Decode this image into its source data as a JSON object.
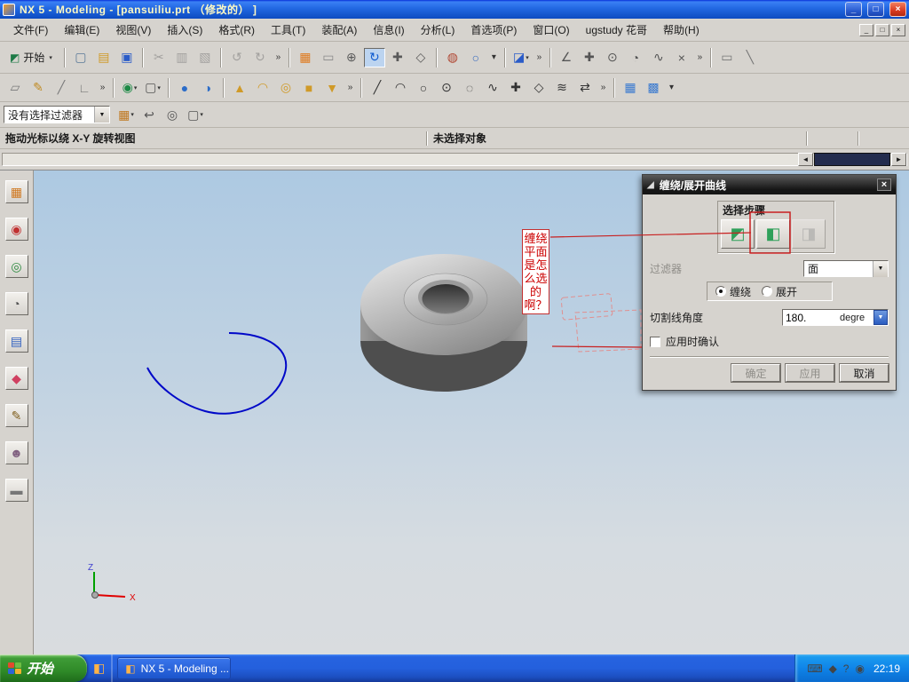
{
  "window": {
    "title": "NX 5 - Modeling - [pansuiliu.prt （修改的） ]",
    "controls": {
      "minimize": "_",
      "restore": "□",
      "close": "×"
    }
  },
  "menu": {
    "items": [
      "文件(F)",
      "编辑(E)",
      "视图(V)",
      "插入(S)",
      "格式(R)",
      "工具(T)",
      "装配(A)",
      "信息(I)",
      "分析(L)",
      "首选项(P)",
      "窗口(O)",
      "ugstudy 花哥",
      "帮助(H)"
    ],
    "mdi_controls": {
      "minimize": "_",
      "restore": "□",
      "close": "×"
    }
  },
  "toolbars": {
    "row1": [
      {
        "name": "start-menu-button",
        "glyph": "◩",
        "color": "#1d7a46",
        "label": "开始",
        "dd": true
      },
      {
        "sep": true
      },
      {
        "name": "new-file-icon",
        "glyph": "▢",
        "color": "#5b7a99"
      },
      {
        "name": "open-icon",
        "glyph": "▤",
        "color": "#d09a28"
      },
      {
        "name": "save-icon",
        "glyph": "▣",
        "color": "#2b5cc8"
      },
      {
        "sep": true
      },
      {
        "name": "cut-icon",
        "glyph": "✂",
        "color": "#6f6f6f",
        "disabled": true
      },
      {
        "name": "copy-icon",
        "glyph": "▥",
        "color": "#6f6f6f",
        "disabled": true
      },
      {
        "name": "paste-icon",
        "glyph": "▧",
        "color": "#6f6f6f",
        "disabled": true
      },
      {
        "sep": true
      },
      {
        "name": "undo-icon",
        "glyph": "↺",
        "color": "#6f6f6f",
        "disabled": true
      },
      {
        "name": "redo-icon",
        "glyph": "↻",
        "color": "#6f6f6f",
        "disabled": true
      },
      {
        "name": "edit-more-icon",
        "glyph": "»",
        "color": "#333",
        "small": true
      },
      {
        "sep": true
      },
      {
        "name": "fit-view-icon",
        "glyph": "▦",
        "color": "#e07a1e"
      },
      {
        "name": "zoom-window-icon",
        "glyph": "▭",
        "color": "#8a8a8a"
      },
      {
        "name": "zoom-icon",
        "glyph": "⊕",
        "color": "#5a5a5a"
      },
      {
        "name": "rotate-view-icon",
        "glyph": "↻",
        "color": "#0f5bd0",
        "active": true
      },
      {
        "name": "pan-view-icon",
        "glyph": "✚",
        "color": "#5a5a5a"
      },
      {
        "name": "perspective-icon",
        "glyph": "◇",
        "color": "#5a5a5a"
      },
      {
        "sep": true
      },
      {
        "name": "shaded-display-icon",
        "glyph": "◍",
        "color": "#b04632"
      },
      {
        "name": "wireframe-display-icon",
        "glyph": "○",
        "color": "#3a6cc0"
      },
      {
        "name": "display-more-icon",
        "glyph": "▾",
        "color": "#333",
        "small": true
      },
      {
        "sep": true
      },
      {
        "name": "orient-view-cube-icon",
        "glyph": "◪",
        "color": "#2b5cc8",
        "dd": true
      },
      {
        "name": "view-more-icon",
        "glyph": "»",
        "color": "#333",
        "small": true
      },
      {
        "sep": true
      },
      {
        "name": "snap-angle-icon",
        "glyph": "∠",
        "color": "#555"
      },
      {
        "name": "snap-point-icon",
        "glyph": "✚",
        "color": "#555"
      },
      {
        "name": "snap-center-icon",
        "glyph": "⊙",
        "color": "#555"
      },
      {
        "name": "snap-quadrant-icon",
        "glyph": "◔",
        "color": "#555"
      },
      {
        "name": "snap-curve-icon",
        "glyph": "∿",
        "color": "#555"
      },
      {
        "name": "snap-intersection-icon",
        "glyph": "×",
        "color": "#555"
      },
      {
        "name": "snap-more-icon",
        "glyph": "»",
        "color": "#333",
        "small": true
      },
      {
        "sep": true
      },
      {
        "name": "measure-distance-icon",
        "glyph": "▭",
        "color": "#777"
      },
      {
        "name": "section-line-icon",
        "glyph": "╲",
        "color": "#777"
      }
    ],
    "row2": [
      {
        "name": "datum-plane-icon",
        "glyph": "▱",
        "color": "#7a7a7a"
      },
      {
        "name": "sketch-icon",
        "glyph": "✎",
        "color": "#c08a20"
      },
      {
        "name": "datum-axis-icon",
        "glyph": "╱",
        "color": "#7a7a7a"
      },
      {
        "name": "datum-csys-icon",
        "glyph": "∟",
        "color": "#7a7a7a"
      },
      {
        "name": "datum-more-icon",
        "glyph": "»",
        "color": "#333",
        "small": true
      },
      {
        "sep": true
      },
      {
        "name": "point-constructor-icon",
        "glyph": "◉",
        "color": "#1d8a46",
        "dd": true
      },
      {
        "name": "rectangle-tool-icon",
        "glyph": "▢",
        "color": "#555",
        "dd": true
      },
      {
        "sep": true
      },
      {
        "name": "shaded-cube-icon",
        "glyph": "●",
        "color": "#2b6cc8"
      },
      {
        "name": "isometric-cube-icon",
        "glyph": "◑",
        "color": "#2b6cc8"
      },
      {
        "sep": true
      },
      {
        "name": "extrude-icon",
        "glyph": "▲",
        "color": "#d09a28"
      },
      {
        "name": "revolve-icon",
        "glyph": "◠",
        "color": "#d09a28"
      },
      {
        "name": "hole-icon",
        "glyph": "◎",
        "color": "#d09a28"
      },
      {
        "name": "block-icon",
        "glyph": "■",
        "color": "#d09a28"
      },
      {
        "name": "shell-icon",
        "glyph": "▼",
        "color": "#d09a28"
      },
      {
        "name": "feature-more-icon",
        "glyph": "»",
        "color": "#333",
        "small": true
      },
      {
        "sep": true
      },
      {
        "name": "line-icon",
        "glyph": "╱",
        "color": "#333"
      },
      {
        "name": "arc-icon",
        "glyph": "◠",
        "color": "#333"
      },
      {
        "name": "circle-icon",
        "glyph": "○",
        "color": "#333"
      },
      {
        "name": "circle-center-icon",
        "glyph": "⊙",
        "color": "#333"
      },
      {
        "name": "ellipse-icon",
        "glyph": "◌",
        "color": "#333"
      },
      {
        "name": "spline-icon",
        "glyph": "∿",
        "color": "#333"
      },
      {
        "name": "point-icon",
        "glyph": "✚",
        "color": "#333"
      },
      {
        "name": "polygon-icon",
        "glyph": "◇",
        "color": "#333"
      },
      {
        "name": "offset-curve-icon",
        "glyph": "≋",
        "color": "#333"
      },
      {
        "name": "mirror-curve-icon",
        "glyph": "⇄",
        "color": "#333"
      },
      {
        "name": "curve-more-icon",
        "glyph": "»",
        "color": "#333",
        "small": true
      },
      {
        "sep": true
      },
      {
        "name": "through-curve-mesh-icon",
        "glyph": "▦",
        "color": "#3a7ad0"
      },
      {
        "name": "swept-surface-icon",
        "glyph": "▩",
        "color": "#3a7ad0"
      },
      {
        "name": "surface-more-icon",
        "glyph": "▾",
        "color": "#333",
        "small": true
      }
    ]
  },
  "selection_bar": {
    "filter_value": "没有选择过滤器",
    "arrow_glyph": "▼",
    "icons": [
      {
        "name": "filter-grid-icon",
        "glyph": "▦",
        "color": "#c07820",
        "dd": true
      },
      {
        "name": "select-previous-icon",
        "glyph": "↩",
        "color": "#555"
      },
      {
        "name": "snap-toggle-icon",
        "glyph": "◎",
        "color": "#555"
      },
      {
        "name": "select-rect-icon",
        "glyph": "▢",
        "color": "#555",
        "dd": true
      }
    ]
  },
  "status_bar": {
    "prompt": "拖动光标以绕 X-Y 旋转视图",
    "status": "未选择对象"
  },
  "scroll_strip": {
    "left_arrow": "◄",
    "right_arrow": "►"
  },
  "resource_bar": {
    "icons": [
      {
        "name": "assembly-navigator-icon",
        "glyph": "▦",
        "color": "#d07820"
      },
      {
        "name": "constraint-navigator-icon",
        "glyph": "◉",
        "color": "#c03030"
      },
      {
        "name": "part-navigator-icon",
        "glyph": "◎",
        "color": "#2e8b40"
      },
      {
        "name": "reuse-library-icon",
        "glyph": "◔",
        "color": "#555"
      },
      {
        "name": "hd3d-tools-icon",
        "glyph": "▤",
        "color": "#3060c0"
      },
      {
        "name": "palette-icon",
        "glyph": "◆",
        "color": "#d04060"
      },
      {
        "name": "history-icon",
        "glyph": "✎",
        "color": "#806020"
      },
      {
        "name": "roles-icon",
        "glyph": "☻",
        "color": "#806080"
      },
      {
        "name": "windows-panel-icon",
        "glyph": "▬",
        "color": "#777"
      }
    ]
  },
  "scene": {
    "note_text": "缠绕平面是怎么选的啊？",
    "triad": {
      "x_label": "X",
      "z_label": "Z"
    }
  },
  "dialog": {
    "title": "缠绕/展开曲线",
    "title_icon": "◢",
    "close_glyph": "×",
    "selection_steps_label": "选择步骤",
    "steps": [
      {
        "name": "step-face-button",
        "glyph": "◩",
        "color": "#2fa05a"
      },
      {
        "name": "step-plane-button",
        "glyph": "◧",
        "color": "#2fa05a"
      },
      {
        "name": "step-curve-button",
        "glyph": "◨",
        "color": "#9a9a9a",
        "disabled": true
      }
    ],
    "filter_label": "过滤器",
    "filter_value": "面",
    "arrow_glyph": "▼",
    "wrap_label": "缠绕",
    "unwrap_label": "展开",
    "angle_label": "切割线角度",
    "angle_value": "180.",
    "angle_unit": "degre",
    "confirm_label": "应用时确认",
    "ok_label": "确定",
    "apply_label": "应用",
    "cancel_label": "取消"
  },
  "taskbar": {
    "start_label": "开始",
    "task_label": "NX 5 - Modeling ...",
    "tray_icons": [
      {
        "name": "ime-keyboard-icon",
        "glyph": "⌨"
      },
      {
        "name": "messenger-tray-icon",
        "glyph": "◆"
      },
      {
        "name": "help-tray-icon",
        "glyph": "?"
      },
      {
        "name": "sound-tray-icon",
        "glyph": "◉"
      }
    ],
    "time": "22:19"
  }
}
